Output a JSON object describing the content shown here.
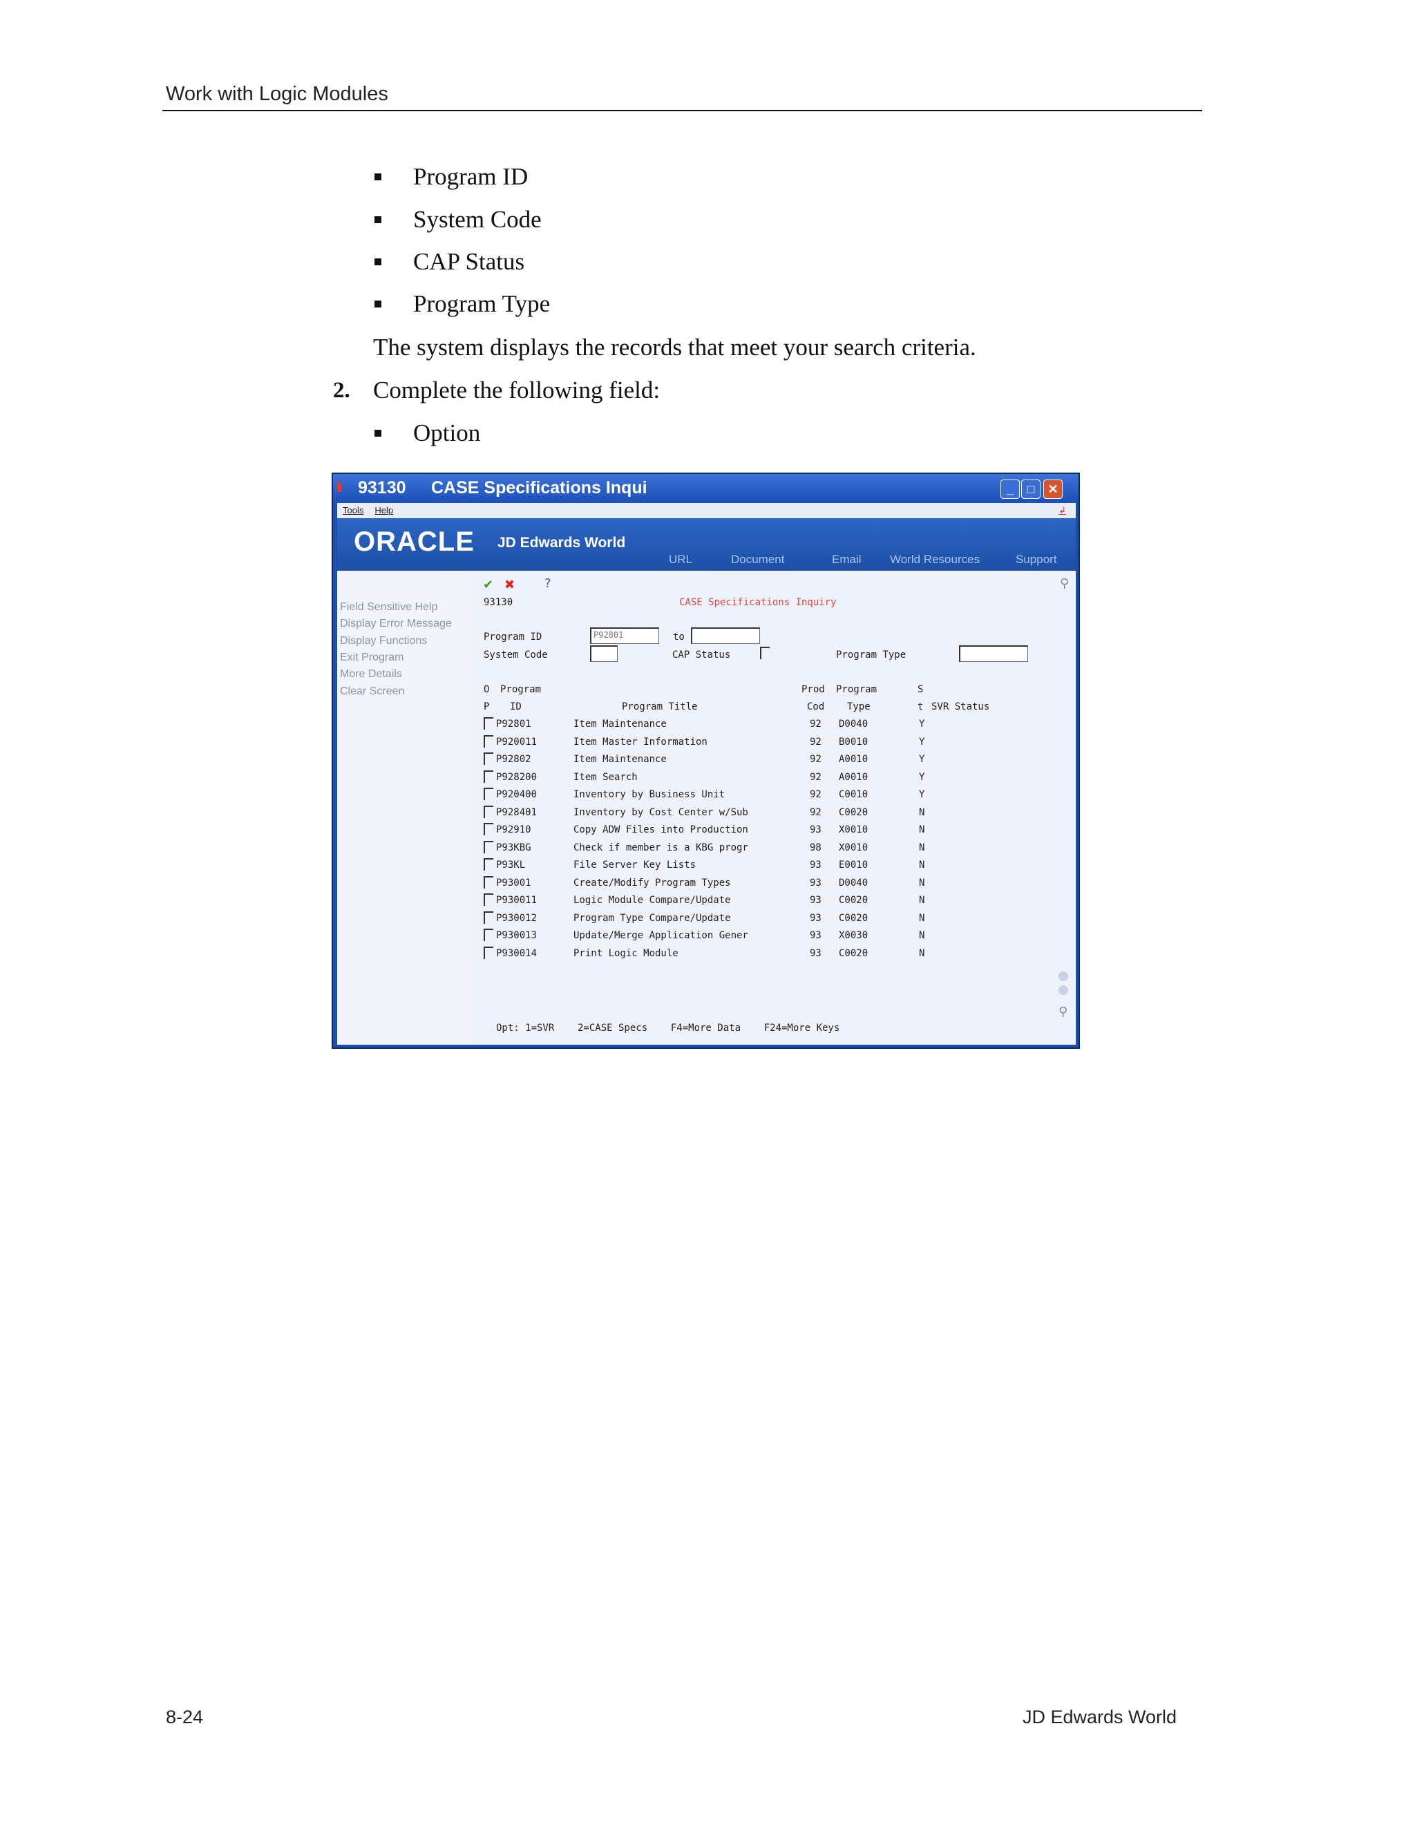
{
  "header": {
    "title": "Work with Logic Modules"
  },
  "bullets_top": [
    "Program ID",
    "System Code",
    "CAP Status",
    "Program Type"
  ],
  "result_text": "The system displays the records that meet your search criteria.",
  "step2": {
    "number": "2.",
    "text": "Complete the following field:",
    "bullets": [
      "Option"
    ]
  },
  "window": {
    "title_number": "93130",
    "title": "CASE Specifications Inqui",
    "menu": [
      "Tools",
      "Help"
    ],
    "logo": "ORACLE",
    "logo_sub": "JD Edwards World",
    "nav": [
      "URL",
      "Document",
      "Email",
      "World Resources",
      "Support"
    ],
    "sidebar": [
      "Field Sensitive Help",
      "Display Error Message",
      "Display Functions",
      "Exit Program",
      "More Details",
      "Clear Screen"
    ],
    "form": {
      "number": "93130",
      "title": "CASE Specifications Inquiry",
      "program_id_label": "Program ID",
      "program_id_value": "P92801",
      "to_label": "to",
      "system_code_label": "System Code",
      "cap_status_label": "CAP Status",
      "program_type_label": "Program Type"
    },
    "columns": {
      "row1": {
        "o": "O",
        "program": "Program",
        "prod": "Prod",
        "ptype": "Program",
        "s": "S"
      },
      "row2": {
        "p": "P",
        "id": "ID",
        "title": "Program Title",
        "cod": "Cod",
        "type": "Type",
        "t": "t",
        "svr": "SVR Status"
      }
    },
    "rows": [
      [
        "P92801",
        "Item Maintenance",
        "92",
        "D0040",
        "Y"
      ],
      [
        "P920011",
        "Item Master Information",
        "92",
        "B0010",
        "Y"
      ],
      [
        "P92802",
        "Item Maintenance",
        "92",
        "A0010",
        "Y"
      ],
      [
        "P928200",
        "Item Search",
        "92",
        "A0010",
        "Y"
      ],
      [
        "P920400",
        "Inventory by Business Unit",
        "92",
        "C0010",
        "Y"
      ],
      [
        "P928401",
        "Inventory by Cost Center w/Sub",
        "92",
        "C0020",
        "N"
      ],
      [
        "P92910",
        "Copy ADW Files into Production",
        "93",
        "X0010",
        "N"
      ],
      [
        "P93KBG",
        "Check if member is a KBG progr",
        "98",
        "X0010",
        "N"
      ],
      [
        "P93KL",
        "File Server Key Lists",
        "93",
        "E0010",
        "N"
      ],
      [
        "P93001",
        "Create/Modify Program Types",
        "93",
        "D0040",
        "N"
      ],
      [
        "P930011",
        "Logic Module Compare/Update",
        "93",
        "C0020",
        "N"
      ],
      [
        "P930012",
        "Program Type Compare/Update",
        "93",
        "C0020",
        "N"
      ],
      [
        "P930013",
        "Update/Merge Application Gener",
        "93",
        "X0030",
        "N"
      ],
      [
        "P930014",
        "Print Logic Module",
        "93",
        "C0020",
        "N"
      ]
    ],
    "footer": "Opt: 1=SVR    2=CASE Specs    F4=More Data    F24=More Keys"
  },
  "footer": {
    "page": "8-24",
    "product": "JD Edwards World"
  }
}
